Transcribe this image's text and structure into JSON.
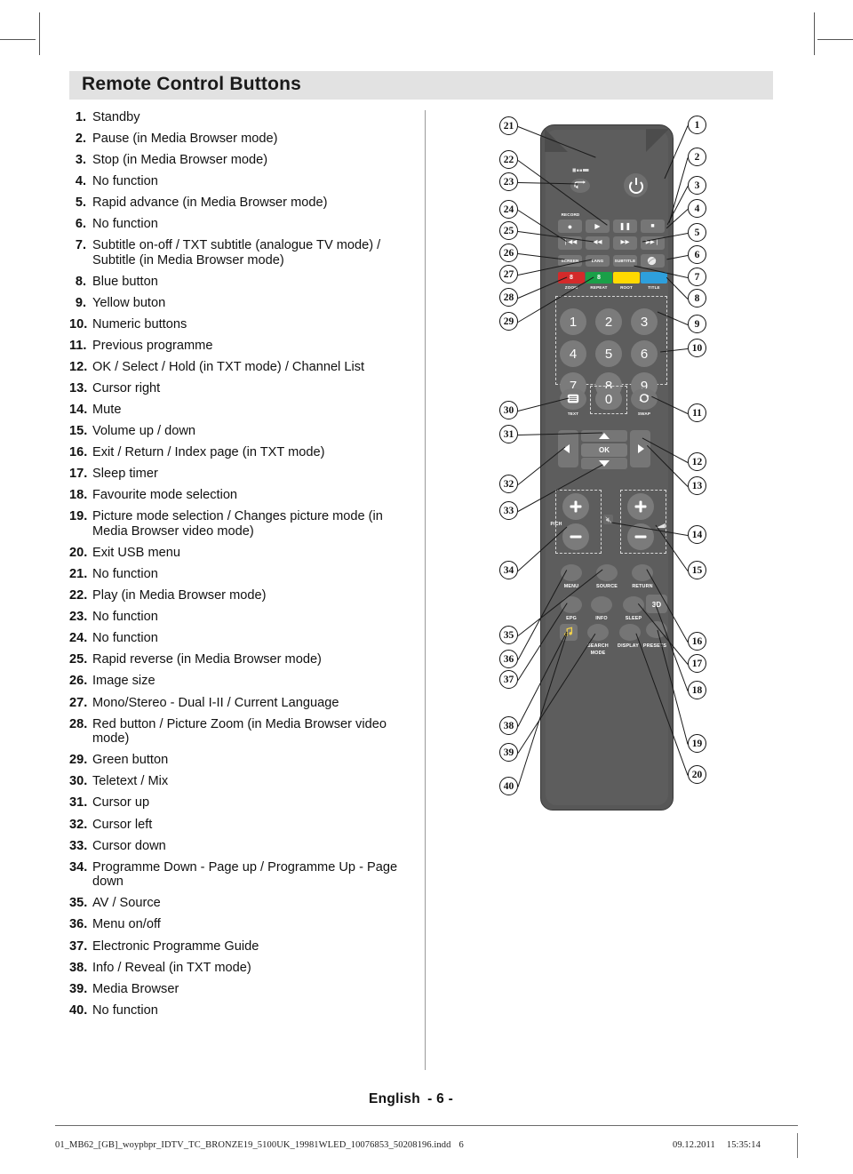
{
  "header": {
    "title": "Remote Control Buttons"
  },
  "list": [
    {
      "num": "1.",
      "text": "Standby"
    },
    {
      "num": "2.",
      "text": "Pause (in Media Browser mode)"
    },
    {
      "num": "3.",
      "text": "Stop (in Media Browser mode)"
    },
    {
      "num": "4.",
      "text": "No function"
    },
    {
      "num": "5.",
      "text": "Rapid advance (in Media Browser mode)"
    },
    {
      "num": "6.",
      "text": "No function"
    },
    {
      "num": "7.",
      "text": "Subtitle on-off / TXT subtitle (analogue TV mode) / Subtitle (in Media Browser mode)"
    },
    {
      "num": "8.",
      "text": "Blue button"
    },
    {
      "num": "9.",
      "text": "Yellow buton"
    },
    {
      "num": "10.",
      "text": "Numeric buttons"
    },
    {
      "num": "11.",
      "text": "Previous programme"
    },
    {
      "num": "12.",
      "text": "OK / Select / Hold (in TXT mode) / Channel List"
    },
    {
      "num": "13.",
      "text": "Cursor right"
    },
    {
      "num": "14.",
      "text": "Mute"
    },
    {
      "num": "15.",
      "text": "Volume up / down"
    },
    {
      "num": "16.",
      "text": "Exit / Return / Index page (in TXT mode)"
    },
    {
      "num": "17.",
      "text": "Sleep timer"
    },
    {
      "num": "18.",
      "text": "Favourite mode selection"
    },
    {
      "num": "19.",
      "text": "Picture mode selection / Changes picture mode (in Media Browser video mode)"
    },
    {
      "num": "20.",
      "text": "Exit USB menu"
    },
    {
      "num": "21.",
      "text": "No function"
    },
    {
      "num": "22.",
      "text": "Play (in Media Browser mode)"
    },
    {
      "num": "23.",
      "text": "No function"
    },
    {
      "num": "24.",
      "text": "No function"
    },
    {
      "num": "25.",
      "text": "Rapid reverse (in Media Browser mode)"
    },
    {
      "num": "26.",
      "text": "Image size"
    },
    {
      "num": "27.",
      "text": "Mono/Stereo - Dual I-II / Current Language"
    },
    {
      "num": "28.",
      "text": "Red button / Picture Zoom (in Media Browser video mode)"
    },
    {
      "num": "29.",
      "text": "Green button"
    },
    {
      "num": "30.",
      "text": "Teletext / Mix"
    },
    {
      "num": "31.",
      "text": "Cursor up"
    },
    {
      "num": "32.",
      "text": "Cursor left"
    },
    {
      "num": "33.",
      "text": "Cursor down"
    },
    {
      "num": "34.",
      "text": "Programme Down - Page up / Programme Up - Page down"
    },
    {
      "num": "35.",
      "text": "AV / Source"
    },
    {
      "num": "36.",
      "text": "Menu on/off"
    },
    {
      "num": "37.",
      "text": "Electronic Programme Guide"
    },
    {
      "num": "38.",
      "text": "Info / Reveal (in TXT mode)"
    },
    {
      "num": "39.",
      "text": "Media Browser"
    },
    {
      "num": "40.",
      "text": "No function"
    }
  ],
  "remote": {
    "labels": {
      "record": "RECORD",
      "screen": "SCREEN",
      "lang": "LANG",
      "subtitle": "SUBTITLE",
      "zoom": "ZOOM",
      "repeat": "REPEAT",
      "root": "ROOT",
      "title": "TITLE",
      "text": "TEXT",
      "swap": "SWAP",
      "ok": "OK",
      "pch": "P/CH",
      "menu": "MENU",
      "source": "SOURCE",
      "return": "RETURN",
      "epg": "EPG",
      "info": "INFO",
      "sleep": "SLEEP",
      "threed": "3D",
      "search_mode_1": "SEARCH",
      "search_mode_2": "MODE",
      "display": "DISPLAY",
      "presets": "PRESETS"
    },
    "keypad": [
      "1",
      "2",
      "3",
      "4",
      "5",
      "6",
      "7",
      "8",
      "9",
      "0"
    ],
    "colors": {
      "red": "#d42a2a",
      "green": "#1aa048",
      "yellow": "#ffd900",
      "blue": "#2e9fdc",
      "body": "#575757",
      "key": "#767676"
    },
    "colour_key_digits": {
      "red": "8",
      "green": "8"
    }
  },
  "callouts_right": [
    "1",
    "2",
    "3",
    "4",
    "5",
    "6",
    "7",
    "8",
    "9",
    "10",
    "11",
    "12",
    "13",
    "14",
    "15",
    "16",
    "17",
    "18",
    "19",
    "20"
  ],
  "callouts_left": [
    "21",
    "22",
    "23",
    "24",
    "25",
    "26",
    "27",
    "28",
    "29",
    "30",
    "31",
    "32",
    "33",
    "34",
    "35",
    "36",
    "37",
    "38",
    "39",
    "40"
  ],
  "pagemark": {
    "language": "English",
    "page": "- 6 -"
  },
  "footer": {
    "filename": "01_MB62_[GB]_woypbpr_IDTV_TC_BRONZE19_5100UK_19981WLED_10076853_50208196.indd",
    "page_number": "6",
    "date": "09.12.2011",
    "time": "15:35:14"
  }
}
